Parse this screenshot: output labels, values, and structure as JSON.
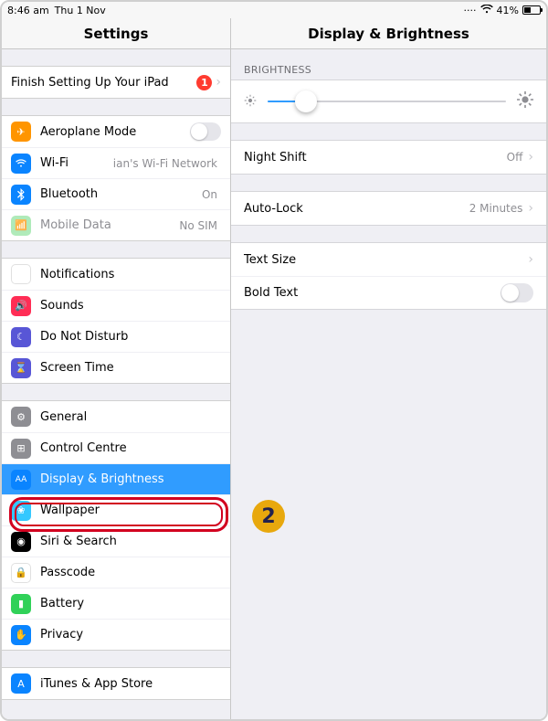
{
  "statusbar": {
    "time": "8:46 am",
    "date": "Thu 1 Nov",
    "battery": "41%"
  },
  "sidebar": {
    "title": "Settings",
    "setup": {
      "label": "Finish Setting Up Your iPad",
      "badge": "1"
    },
    "net": {
      "aeroplane": "Aeroplane Mode",
      "wifi": "Wi-Fi",
      "wifi_val": "ian's Wi-Fi Network",
      "bt": "Bluetooth",
      "bt_val": "On",
      "mobile": "Mobile Data",
      "mobile_val": "No SIM"
    },
    "notif": {
      "notifications": "Notifications",
      "sounds": "Sounds",
      "dnd": "Do Not Disturb",
      "screentime": "Screen Time"
    },
    "sys": {
      "general": "General",
      "control": "Control Centre",
      "display": "Display & Brightness",
      "wallpaper": "Wallpaper",
      "siri": "Siri & Search",
      "passcode": "Passcode",
      "battery": "Battery",
      "privacy": "Privacy"
    },
    "store": {
      "itunes": "iTunes & App Store"
    }
  },
  "detail": {
    "title": "Display & Brightness",
    "brightness_header": "BRIGHTNESS",
    "nightshift": {
      "label": "Night Shift",
      "value": "Off"
    },
    "autolock": {
      "label": "Auto-Lock",
      "value": "2 Minutes"
    },
    "textsize": "Text Size",
    "boldtext": "Bold Text"
  },
  "annotation": {
    "badge": "2"
  }
}
